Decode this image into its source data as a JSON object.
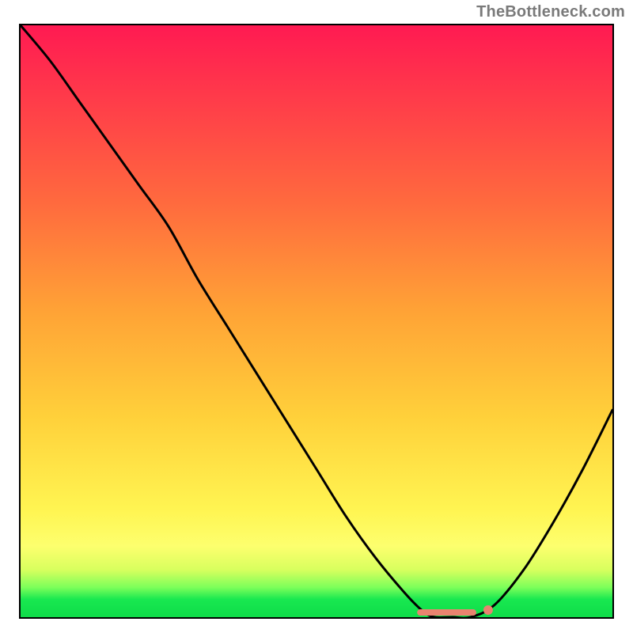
{
  "attribution": "TheBottleneck.com",
  "chart_data": {
    "type": "line",
    "title": "",
    "xlabel": "",
    "ylabel": "",
    "xlim": [
      0,
      100
    ],
    "ylim": [
      0,
      100
    ],
    "series": [
      {
        "name": "bottleneck-curve",
        "x": [
          0,
          5,
          10,
          15,
          20,
          25,
          30,
          35,
          40,
          45,
          50,
          55,
          60,
          65,
          68,
          70,
          73,
          76,
          80,
          85,
          90,
          95,
          100
        ],
        "y": [
          100,
          94,
          87,
          80,
          73,
          66,
          57,
          49,
          41,
          33,
          25,
          17,
          10,
          4,
          1,
          0,
          0,
          0,
          2,
          8,
          16,
          25,
          35
        ]
      }
    ],
    "markers": [
      {
        "name": "optimal-point",
        "x": 79,
        "y": 1.2
      },
      {
        "name": "optimal-band-left",
        "x": 67,
        "y": 0.8
      },
      {
        "name": "optimal-band-right",
        "x": 77,
        "y": 0.8
      }
    ],
    "gradient_stops": [
      {
        "pct": 0,
        "color": "#ff1a52"
      },
      {
        "pct": 50,
        "color": "#ffb038"
      },
      {
        "pct": 85,
        "color": "#fff760"
      },
      {
        "pct": 100,
        "color": "#0fdc49"
      }
    ]
  }
}
